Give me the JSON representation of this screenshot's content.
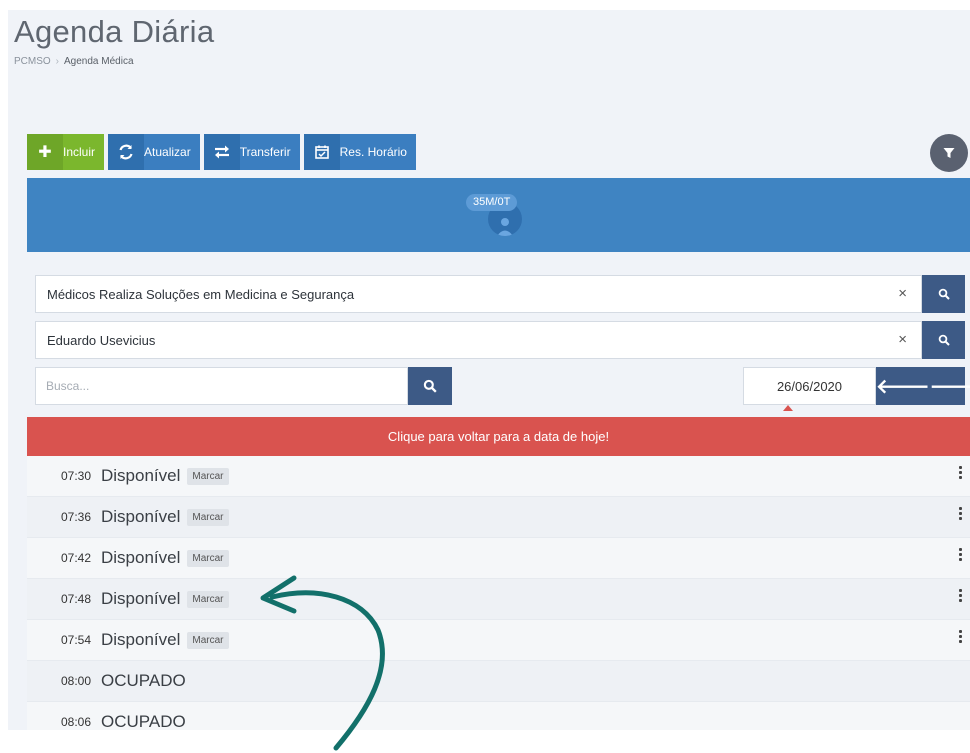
{
  "page": {
    "title": "Agenda Diária",
    "breadcrumb": [
      "PCMSO",
      "Agenda Médica"
    ]
  },
  "toolbar": {
    "include_label": "Incluir",
    "refresh_label": "Atualizar",
    "transfer_label": "Transferir",
    "reserve_label": "Res. Horário"
  },
  "banner": {
    "session_badge": "35M/0T"
  },
  "filters": {
    "clinic": "Médicos Realiza Soluções em Medicina e Segurança",
    "doctor": "Eduardo Usevicius",
    "clear_symbol": "×",
    "search_placeholder": "Busca...",
    "date": "26/06/2020",
    "prev_symbol": "🡐",
    "next_symbol": "🡒"
  },
  "today_bar": {
    "label": "Clique para voltar para a data de hoje!"
  },
  "slots": [
    {
      "time": "07:30",
      "status": "Disponível",
      "action": "Marcar"
    },
    {
      "time": "07:36",
      "status": "Disponível",
      "action": "Marcar"
    },
    {
      "time": "07:42",
      "status": "Disponível",
      "action": "Marcar"
    },
    {
      "time": "07:48",
      "status": "Disponível",
      "action": "Marcar"
    },
    {
      "time": "07:54",
      "status": "Disponível",
      "action": "Marcar"
    },
    {
      "time": "08:00",
      "status": "OCUPADO"
    },
    {
      "time": "08:06",
      "status": "OCUPADO"
    }
  ],
  "colors": {
    "primary_blue": "#3b7ec0",
    "success_green": "#7bb72d",
    "danger_red": "#d9534f",
    "search_button": "#3d5a86",
    "annotation_teal": "#12706a"
  }
}
